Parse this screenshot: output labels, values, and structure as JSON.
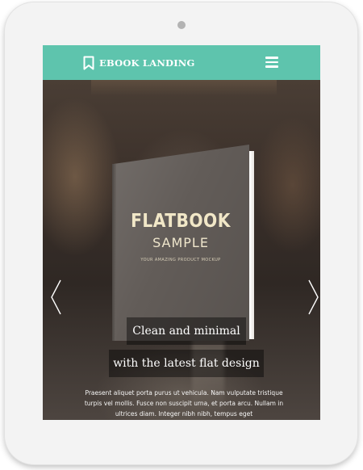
{
  "header": {
    "brand": "EBOOK LANDING",
    "brand_icon": "bookmark-icon",
    "menu_icon": "hamburger-menu-icon",
    "accent_color": "#5ec4ad"
  },
  "slider": {
    "prev_icon": "chevron-left-icon",
    "next_icon": "chevron-right-icon"
  },
  "book": {
    "title": "FLATBOOK",
    "subtitle": "SAMPLE",
    "tagline": "YOUR AMAZING PRODUCT MOCKUP"
  },
  "hero": {
    "caption_1": "Clean and minimal",
    "caption_2": "with the latest flat design",
    "body": "Praesent aliquet porta purus ut vehicula. Nam vulputate tristique turpis vel mollis. Fusce non suscipit urna, et porta arcu. Nullam in ultrices diam. Integer nibh nibh, tempus eget"
  }
}
